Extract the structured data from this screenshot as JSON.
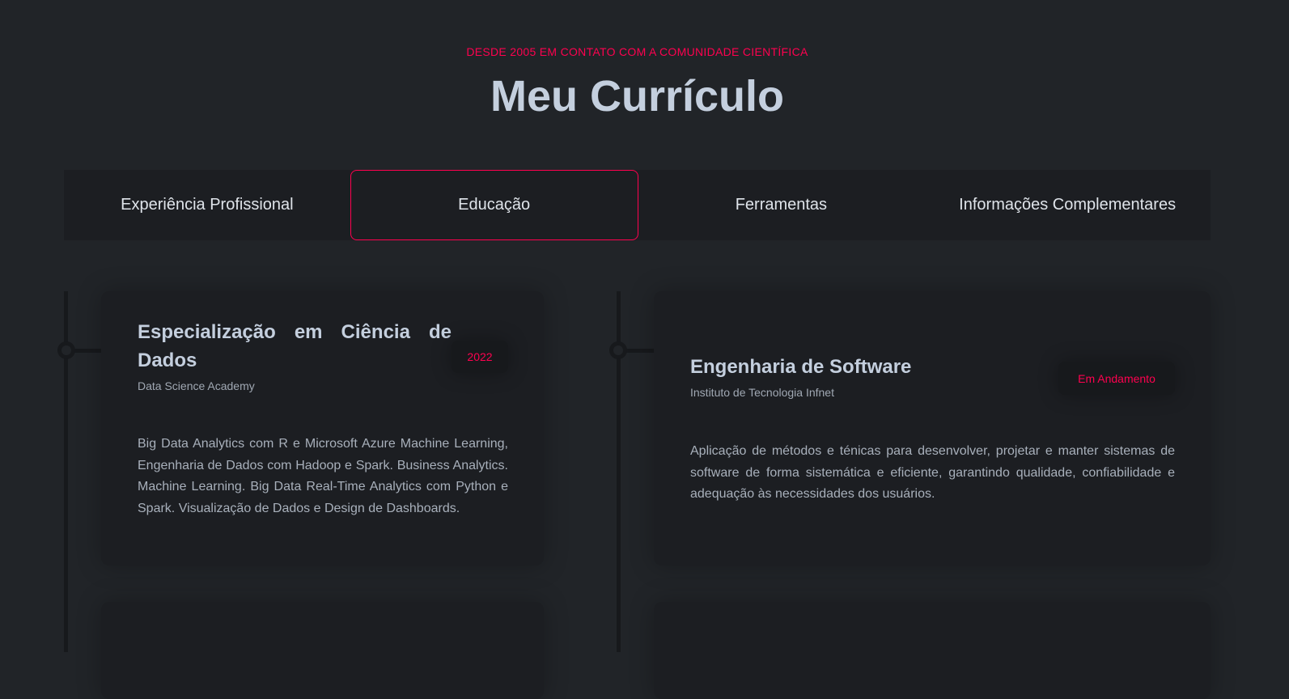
{
  "header": {
    "subtitle": "DESDE 2005 EM CONTATO COM A COMUNIDADE CIENTÍFICA",
    "title": "Meu Currículo"
  },
  "tabs": [
    {
      "label": "Experiência Profissional"
    },
    {
      "label": "Educação",
      "active": true
    },
    {
      "label": "Ferramentas"
    },
    {
      "label": "Informações Complementares"
    }
  ],
  "education": [
    {
      "title": "Especialização em Ciência de Dados",
      "institution": "Data Science Academy",
      "badge": "2022",
      "description": "Big Data Analytics com R e Microsoft Azure Machine Learning, Engenharia de Dados com Hadoop e Spark. Business Analytics. Machine Learning. Big Data Real-Time Analytics com Python e Spark. Visualização de Dados e Design de Dashboards."
    },
    {
      "title": "Engenharia de Software",
      "institution": "Instituto de Tecnologia Infnet",
      "badge": "Em Andamento",
      "description": "Aplicação de métodos e ténicas para desenvolver, projetar e manter sistemas de software de forma sistemática e eficiente, garantindo qualidade, confiabilidade e adequação às necessidades dos usuários."
    }
  ],
  "colors": {
    "accent": "#ff014f",
    "background": "#212428",
    "card": "#1c1e22"
  }
}
